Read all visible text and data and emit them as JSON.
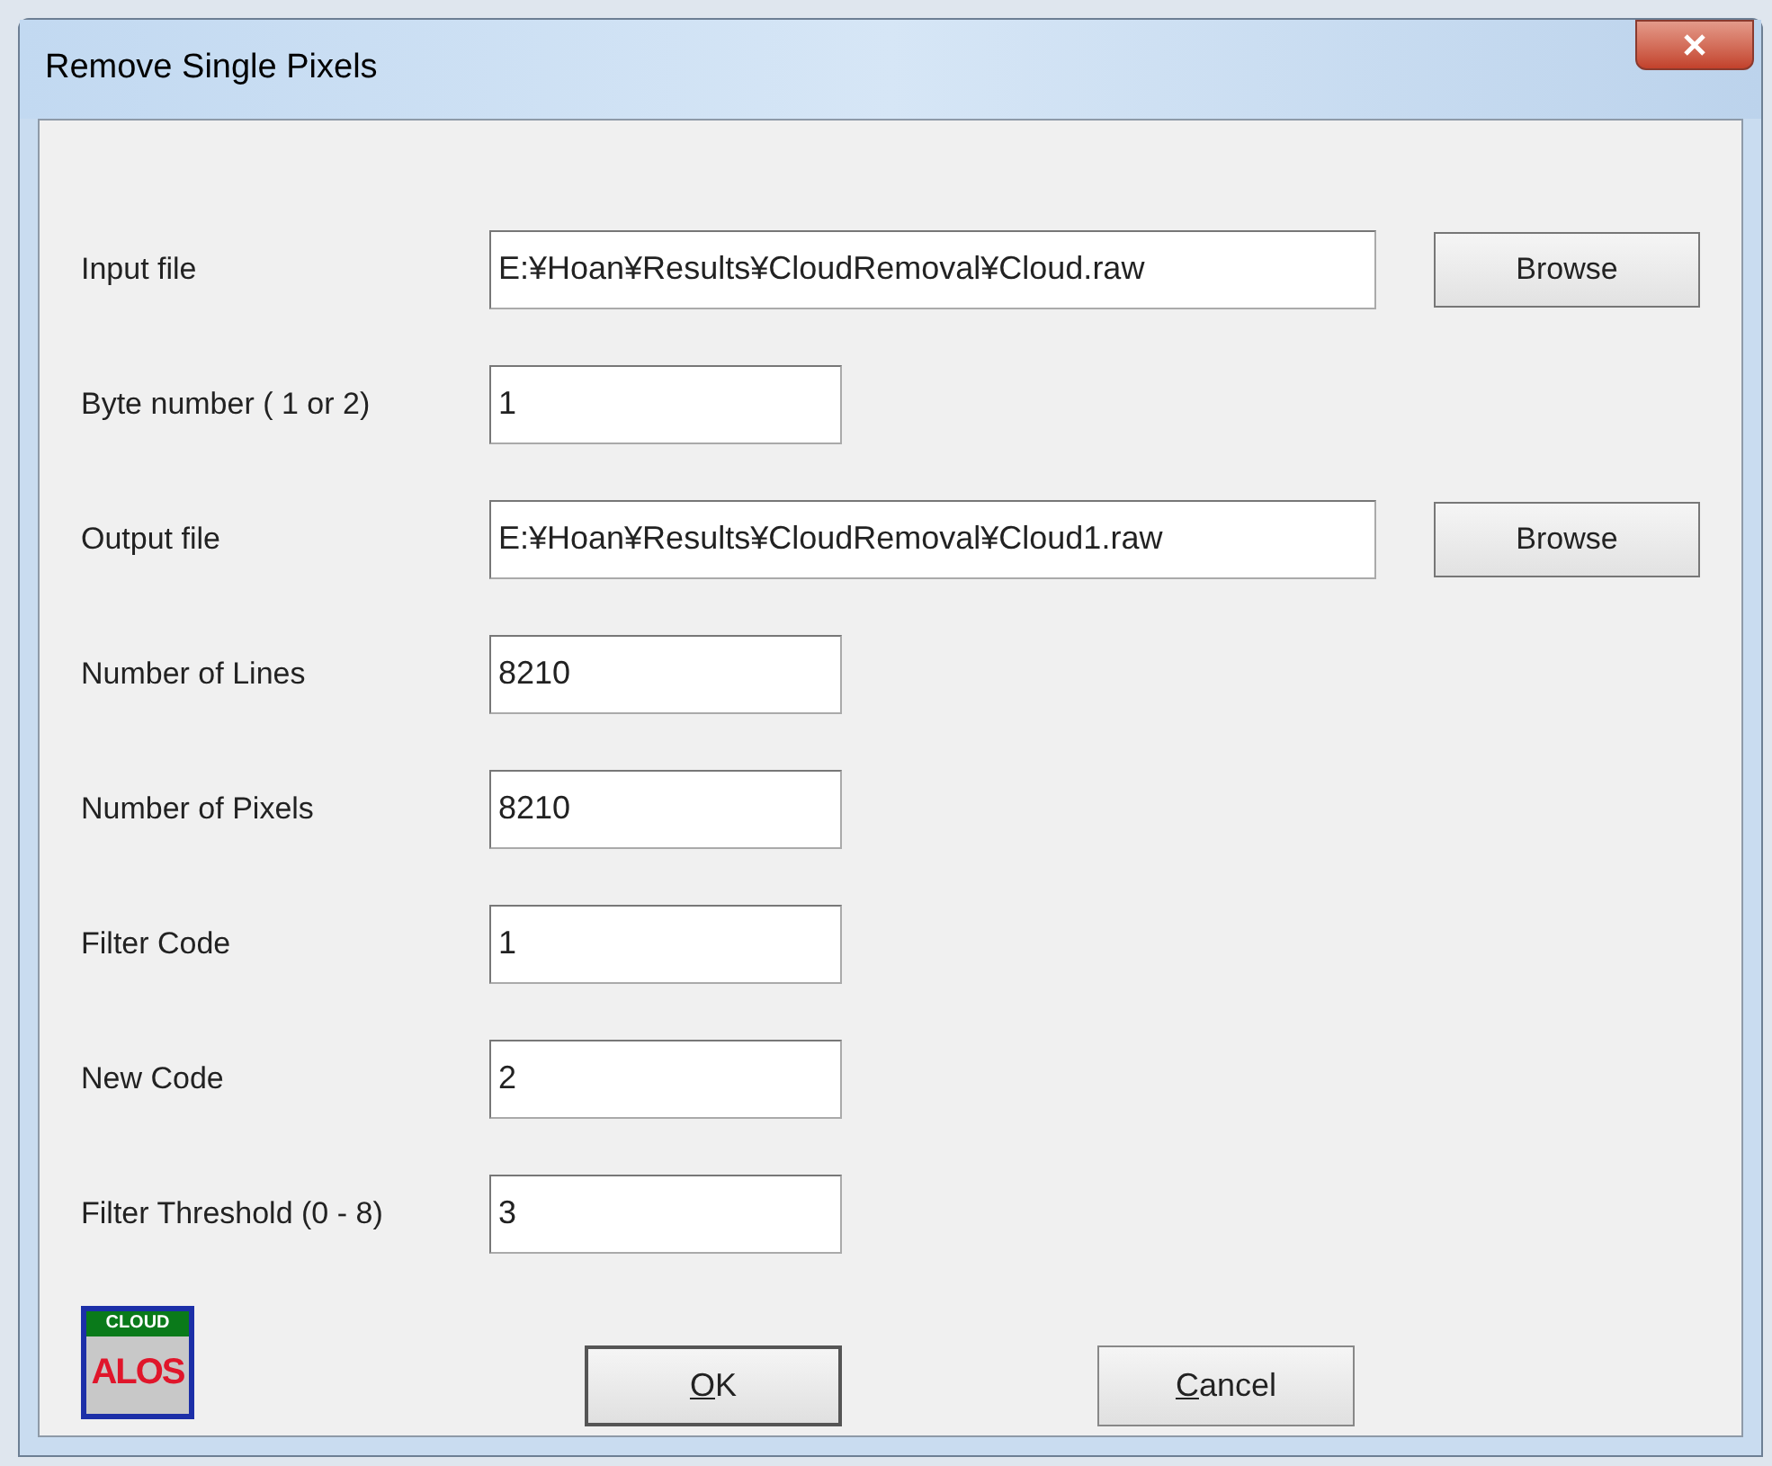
{
  "window": {
    "title": "Remove Single Pixels"
  },
  "fields": [
    {
      "label": "Input file",
      "value": "E:¥Hoan¥Results¥CloudRemoval¥Cloud.raw",
      "kind": "path",
      "button": "Browse"
    },
    {
      "label": "Byte number ( 1 or 2)",
      "value": "1",
      "kind": "short"
    },
    {
      "label": "Output file",
      "value": "E:¥Hoan¥Results¥CloudRemoval¥Cloud1.raw",
      "kind": "path",
      "button": "Browse"
    },
    {
      "label": "Number of Lines",
      "value": "8210",
      "kind": "short"
    },
    {
      "label": "Number of Pixels",
      "value": "8210",
      "kind": "short"
    },
    {
      "label": "Filter Code",
      "value": "1",
      "kind": "short"
    },
    {
      "label": "New Code",
      "value": "2",
      "kind": "short"
    },
    {
      "label": "Filter Threshold (0 - 8)",
      "value": "3",
      "kind": "short"
    }
  ],
  "logo": {
    "top": "CLOUD",
    "bottom": "ALOS"
  },
  "buttons": [
    {
      "label": "OK",
      "access_key_underlined": true
    },
    {
      "label": "Cancel",
      "access_key_underlined": true
    }
  ]
}
